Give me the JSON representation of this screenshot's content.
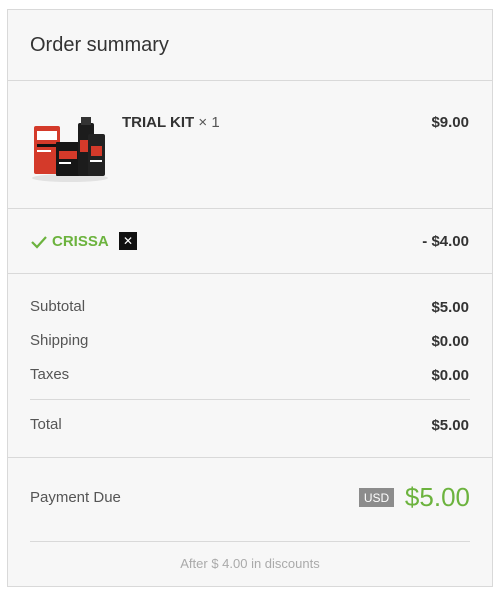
{
  "summary": {
    "title": "Order summary",
    "item": {
      "name": "TRIAL KIT",
      "qty": "× 1",
      "price": "$9.00",
      "image_alt": "AOS trial kit products"
    },
    "discount": {
      "code": "CRISSA",
      "remove_label": "✕",
      "amount": "- $4.00"
    },
    "rows": {
      "subtotal": {
        "label": "Subtotal",
        "value": "$5.00"
      },
      "shipping": {
        "label": "Shipping",
        "value": "$0.00"
      },
      "taxes": {
        "label": "Taxes",
        "value": "$0.00"
      },
      "total": {
        "label": "Total",
        "value": "$5.00"
      }
    },
    "payment": {
      "label": "Payment Due",
      "currency": "USD",
      "amount": "$5.00"
    },
    "note": "After $ 4.00 in discounts"
  },
  "colors": {
    "accent_green": "#6cb33e",
    "currency_badge": "#8c8c8c",
    "product_red": "#d43a2a"
  }
}
